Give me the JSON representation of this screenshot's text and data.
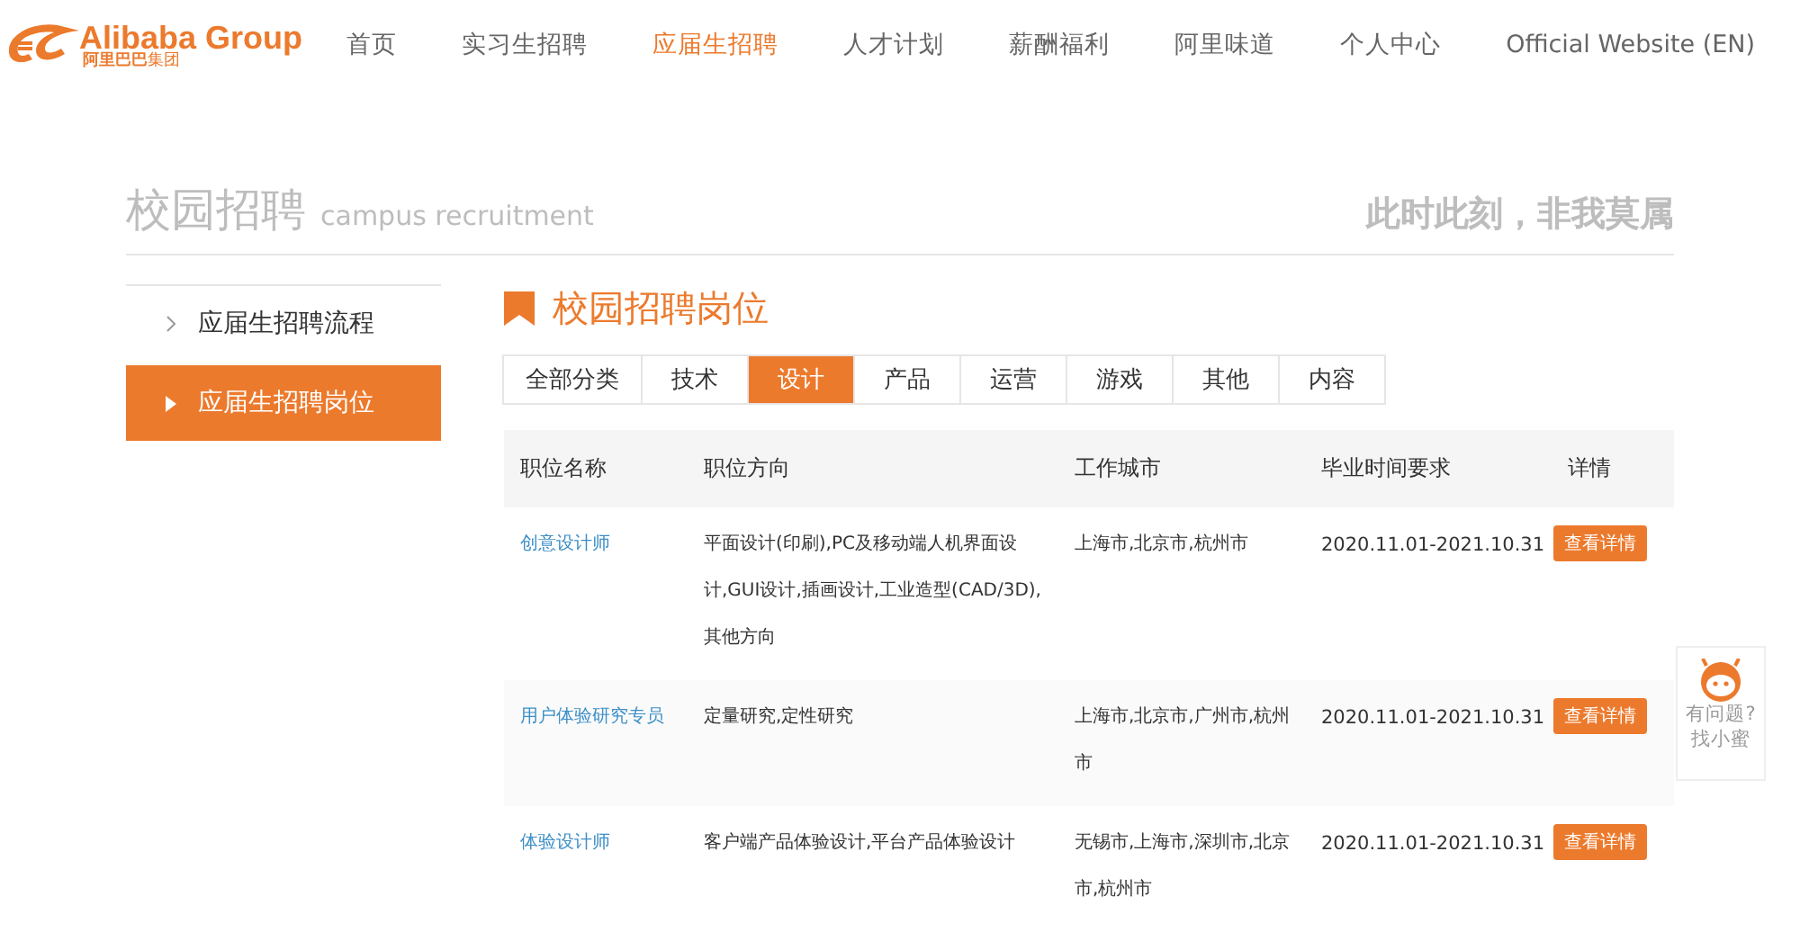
{
  "logo": {
    "name": "Alibaba Group",
    "subtitle": "**阿里巴巴**集团"
  },
  "nav": [
    {
      "label": "首页",
      "selected": false
    },
    {
      "label": "实习生招聘",
      "selected": false
    },
    {
      "label": "应届生招聘",
      "selected": true
    },
    {
      "label": "人才计划",
      "selected": false
    },
    {
      "label": "薪酬福利",
      "selected": false
    },
    {
      "label": "阿里味道",
      "selected": false
    },
    {
      "label": "个人中心",
      "selected": false
    },
    {
      "label": "Official Website (EN)",
      "selected": false
    }
  ],
  "banner": {
    "title": "校园招聘",
    "subtitle": "campus recruitment",
    "slogan": "此时此刻，非我莫属"
  },
  "sidebar": {
    "items": [
      {
        "label": "应届生招聘流程",
        "selected": false
      },
      {
        "label": "应届生招聘岗位",
        "selected": true
      }
    ]
  },
  "section_title": "校园招聘岗位",
  "tabs": [
    {
      "label": "全部分类",
      "selected": false
    },
    {
      "label": "技术",
      "selected": false
    },
    {
      "label": "设计",
      "selected": true
    },
    {
      "label": "产品",
      "selected": false
    },
    {
      "label": "运营",
      "selected": false
    },
    {
      "label": "游戏",
      "selected": false
    },
    {
      "label": "其他",
      "selected": false
    },
    {
      "label": "内容",
      "selected": false
    }
  ],
  "table": {
    "columns": [
      "职位名称",
      "职位方向",
      "工作城市",
      "毕业时间要求",
      "详情"
    ],
    "rows": [
      {
        "title": "创意设计师",
        "direction": "平面设计(印刷),PC及移动端人机界面设计,GUI设计,插画设计,工业造型(CAD/3D),其他方向",
        "cities": "上海市,北京市,杭州市",
        "graduation": "2020.11.01-2021.10.31",
        "action": "查看详情"
      },
      {
        "title": "用户体验研究专员",
        "direction": "定量研究,定性研究",
        "cities": "上海市,北京市,广州市,杭州市",
        "graduation": "2020.11.01-2021.10.31",
        "action": "查看详情"
      },
      {
        "title": "体验设计师",
        "direction": "客户端产品体验设计,平台产品体验设计",
        "cities": "无锡市,上海市,深圳市,北京市,杭州市",
        "graduation": "2020.11.01-2021.10.31",
        "action": "查看详情"
      }
    ]
  },
  "help_widget": {
    "line_1": "有问题?",
    "line_2": "找小蜜"
  }
}
